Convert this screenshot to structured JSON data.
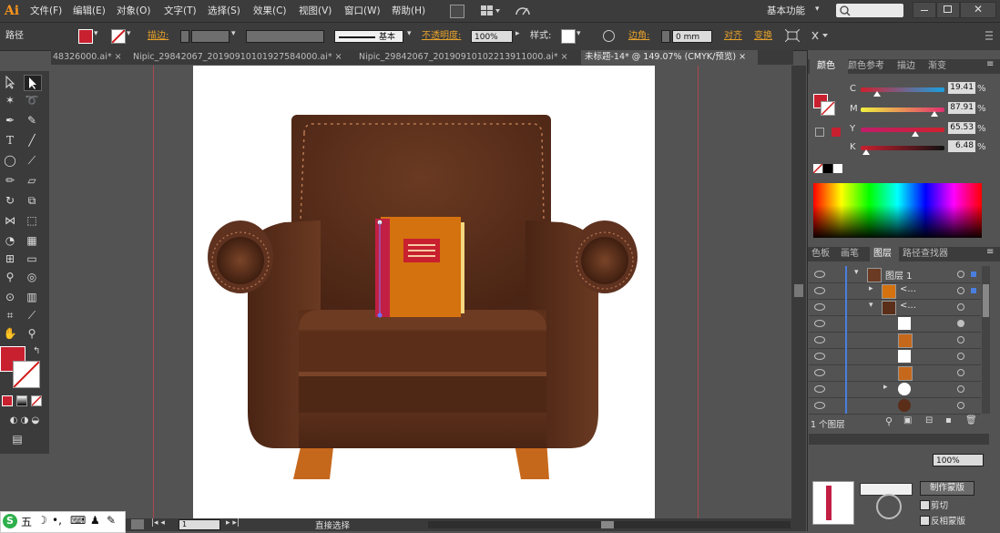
{
  "app": {
    "logo": "Ai"
  },
  "menu": {
    "items": [
      "文件(F)",
      "编辑(E)",
      "对象(O)",
      "文字(T)",
      "选择(S)",
      "效果(C)",
      "视图(V)",
      "窗口(W)",
      "帮助(H)"
    ],
    "workspace": "基本功能"
  },
  "control": {
    "object_type": "路径",
    "stroke_label": "描边:",
    "stroke_style": "基本",
    "opacity_label": "不透明度:",
    "opacity_value": "100%",
    "style_label": "样式:",
    "corner_label": "边角:",
    "corner_value": "0 mm",
    "align_label": "对齐",
    "transform_label": "变换",
    "fill_color": "#c8202f"
  },
  "tabs": [
    {
      "label": "48326000.ai* ×"
    },
    {
      "label": "Nipic_29842067_20190910101927584000.ai* ×"
    },
    {
      "label": "Nipic_29842067_20190910102213911000.ai* ×"
    },
    {
      "label": "未标题-14* @ 149.07% (CMYK/预览) ×"
    }
  ],
  "color_panel": {
    "tabs": [
      "颜色",
      "颜色参考",
      "描边",
      "渐变"
    ],
    "c_label": "C",
    "c_value": "19.41",
    "c_pct": 19.41,
    "m_label": "M",
    "m_value": "87.91",
    "m_pct": 87.91,
    "y_label": "Y",
    "y_value": "65.53",
    "y_pct": 65.53,
    "k_label": "K",
    "k_value": "6.48",
    "k_pct": 6.48,
    "unit": "%"
  },
  "layers_panel": {
    "tabs": [
      "色板",
      "画笔",
      "图层",
      "路径查找器"
    ],
    "layer_name": "图层 1",
    "sublayer_1": "<...",
    "sublayer_2": "<...",
    "footer_count": "1 个图层"
  },
  "lower_panel": {
    "clip_label": "剪切",
    "invert_label": "反相蒙版",
    "make_mask_button": "制作蒙版",
    "opacity_value": "100%"
  },
  "status": {
    "zoom": "149.07%",
    "page": "1",
    "tool_name": "直接选择"
  },
  "taskbar": {
    "label": "五"
  }
}
